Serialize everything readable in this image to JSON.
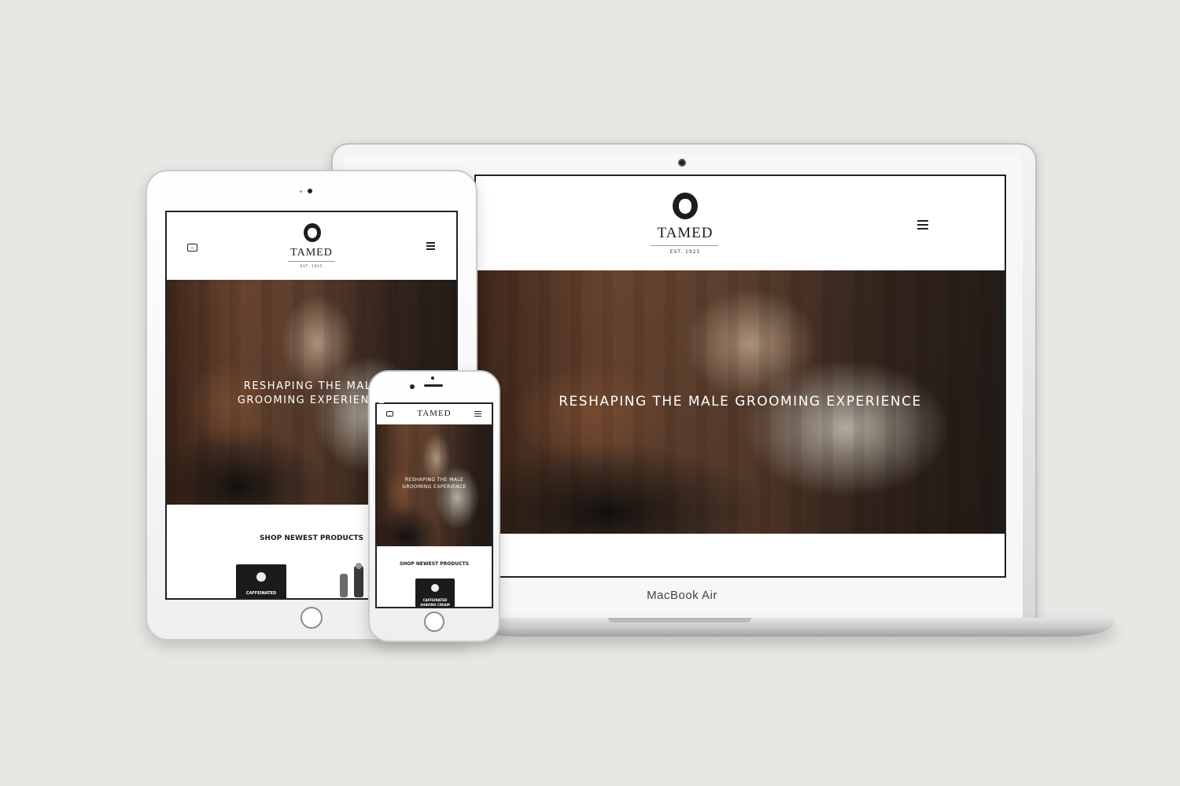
{
  "brand": {
    "name": "TAMED",
    "tagline": "EST. 1925"
  },
  "hero": {
    "headline": "RESHAPING THE MALE GROOMING EXPERIENCE",
    "headline_tablet_line1": "RESHAPING THE MALE",
    "headline_tablet_line2": "GROOMING EXPERIENCE",
    "headline_phone_line1": "RESHAPING THE MALE",
    "headline_phone_line2": "GROOMING EXPERIENCE"
  },
  "products": {
    "section_title": "SHOP NEWEST PRODUCTS",
    "item1_line1": "CAFFEINATED",
    "item1_line2": "SHAVING CREAM"
  },
  "devices": {
    "laptop_label": "MacBook Air"
  },
  "icons": {
    "menu": "hamburger-icon",
    "mail": "envelope-icon",
    "logo": "lion-logo-icon"
  },
  "colors": {
    "background": "#e9e7e3",
    "text_dark": "#1b1b1b",
    "hero_text": "#ffffff"
  }
}
